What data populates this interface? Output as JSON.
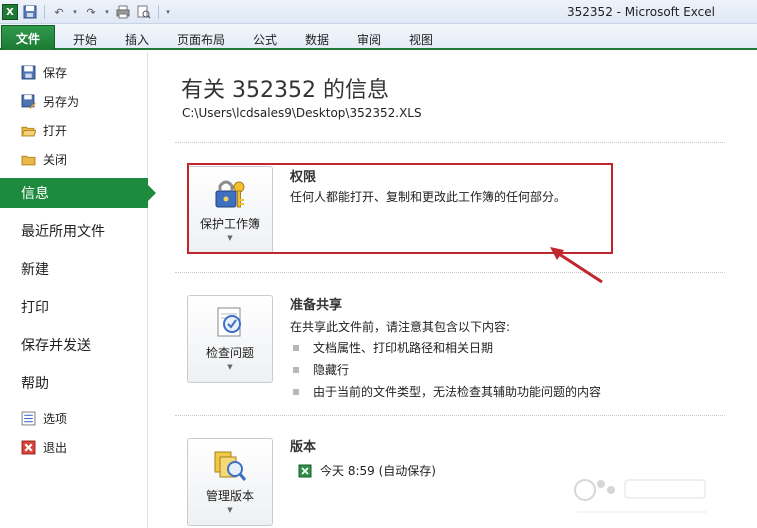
{
  "window": {
    "title": "352352 - Microsoft Excel"
  },
  "ribbon": {
    "tabs": [
      "文件",
      "开始",
      "插入",
      "页面布局",
      "公式",
      "数据",
      "审阅",
      "视图"
    ]
  },
  "nav": {
    "small_top": [
      {
        "label": "保存",
        "icon": "save-icon"
      },
      {
        "label": "另存为",
        "icon": "save-as-icon"
      },
      {
        "label": "打开",
        "icon": "open-folder-icon"
      },
      {
        "label": "关闭",
        "icon": "close-folder-icon"
      }
    ],
    "big": [
      "信息",
      "最近所用文件",
      "新建",
      "打印",
      "保存并发送",
      "帮助"
    ],
    "small_bottom": [
      {
        "label": "选项",
        "icon": "options-icon"
      },
      {
        "label": "退出",
        "icon": "exit-icon"
      }
    ]
  },
  "info": {
    "title": "有关 352352 的信息",
    "path": "C:\\Users\\lcdsales9\\Desktop\\352352.XLS",
    "permissions": {
      "button": "保护工作簿",
      "heading": "权限",
      "text": "任何人都能打开、复制和更改此工作簿的任何部分。"
    },
    "prepare": {
      "button": "检查问题",
      "heading": "准备共享",
      "intro": "在共享此文件前，请注意其包含以下内容:",
      "bullets": [
        "文档属性、打印机路径和相关日期",
        "隐藏行",
        "由于当前的文件类型，无法检查其辅助功能问题的内容"
      ]
    },
    "versions": {
      "button": "管理版本",
      "heading": "版本",
      "item": "今天 8:59 (自动保存)"
    }
  },
  "accent_color": "#1e8a3e",
  "highlight_color": "#c0262e"
}
